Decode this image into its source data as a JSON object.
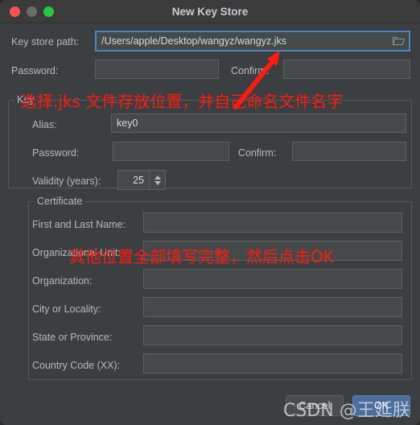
{
  "window": {
    "title": "New Key Store",
    "controls": {
      "close": "close-button",
      "minimize": "minimize-button",
      "maximize": "maximize-button"
    }
  },
  "keystore": {
    "path_label": "Key store path:",
    "path_value": "/Users/apple/Desktop/wangyz/wangyz.jks",
    "browse_icon": "folder-icon",
    "password_label": "Password:",
    "password_value": "",
    "confirm_label": "Confirm:",
    "confirm_value": ""
  },
  "key": {
    "group_label": "Key",
    "alias_label": "Alias:",
    "alias_value": "key0",
    "password_label": "Password:",
    "password_value": "",
    "confirm_label": "Confirm:",
    "confirm_value": "",
    "validity_label": "Validity (years):",
    "validity_value": "25"
  },
  "certificate": {
    "group_label": "Certificate",
    "fields": [
      {
        "label": "First and Last Name:",
        "value": ""
      },
      {
        "label": "Organizational Unit:",
        "value": ""
      },
      {
        "label": "Organization:",
        "value": ""
      },
      {
        "label": "City or Locality:",
        "value": ""
      },
      {
        "label": "State or Province:",
        "value": ""
      },
      {
        "label": "Country Code (XX):",
        "value": ""
      }
    ]
  },
  "buttons": {
    "cancel": "Cancel",
    "ok": "OK"
  },
  "annotations": [
    {
      "text": "选择.jks 文件存放位置，并自己命名文件名字",
      "color": "#ff1a11"
    },
    {
      "text": "其他位置全部填写完整，然后点击OK",
      "color": "#ff1a11"
    }
  ],
  "watermark": {
    "text": "CSDN @王延朕"
  },
  "colors": {
    "window_bg": "#3c3f41",
    "titlebar_bg": "#3b3b3b",
    "field_bg": "#45494a",
    "field_border": "#5c6063",
    "focus_border": "#4b83c0",
    "primary_button": "#4b6f9c",
    "annotation_red": "#ff1a11",
    "light_close": "#f9544f",
    "light_min": "#6b6b6b",
    "light_max": "#28c840"
  }
}
